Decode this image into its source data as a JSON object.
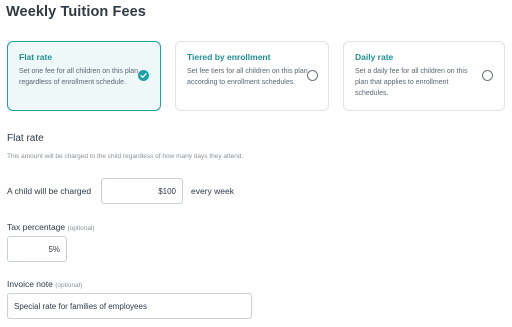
{
  "page": {
    "title": "Weekly Tuition Fees"
  },
  "plans": [
    {
      "title": "Flat rate",
      "description": "Set one fee for all children on this plan, regardless of enrollment schedule.",
      "selected": true
    },
    {
      "title": "Tiered by enrollment",
      "description": "Set fee tiers for all children on this plan according to enrollment schedules.",
      "selected": false
    },
    {
      "title": "Daily rate",
      "description": "Set a daily fee for all children on this plan that applies to enrollment schedules.",
      "selected": false
    }
  ],
  "flat_rate": {
    "heading": "Flat rate",
    "subtitle": "This amount will be charged to the child regardless of how many days they attend.",
    "charge_label": "A child will be charged",
    "amount": "$100",
    "period": "every week"
  },
  "tax": {
    "label": "Tax percentage",
    "optional": "(optional)",
    "value": "5%"
  },
  "invoice_note": {
    "label": "Invoice note",
    "optional": "(optional)",
    "value": "Special rate for families of employees"
  },
  "colors": {
    "accent": "#1ba1a6",
    "selected_bg": "#eef8f8"
  }
}
